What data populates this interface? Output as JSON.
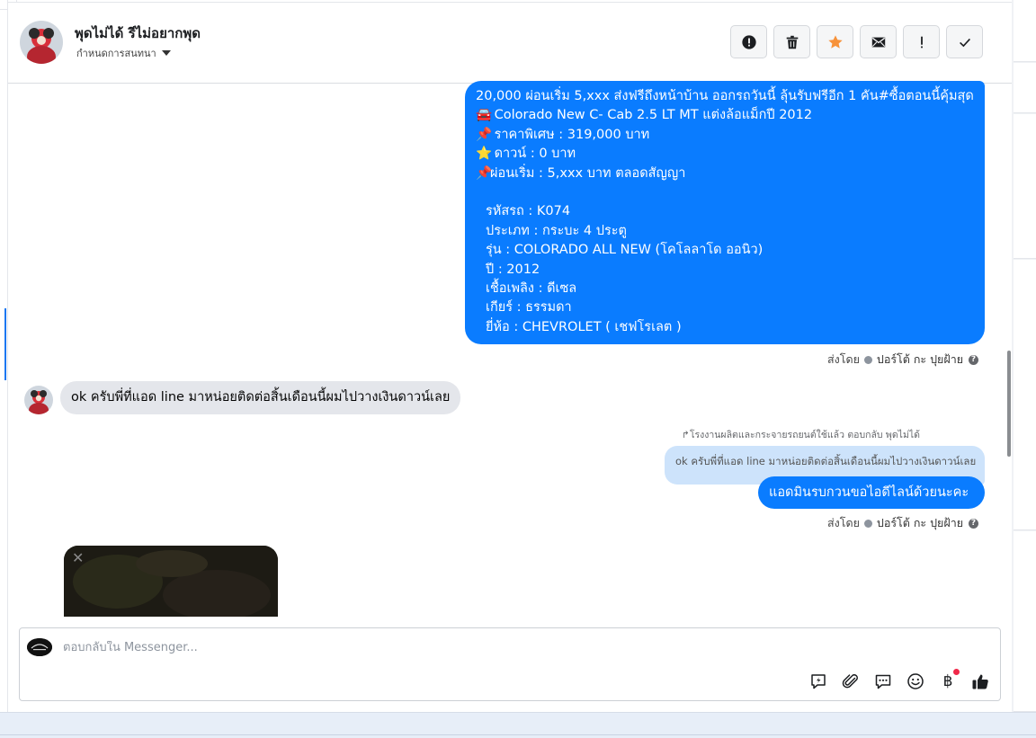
{
  "header": {
    "contact_name": "พุดไม่ได้ รีไม่อยากพุด",
    "conversation_setting": "กำหนดการสนทนา",
    "actions": [
      {
        "name": "spam-button",
        "icon": "alert-circle-icon"
      },
      {
        "name": "delete-button",
        "icon": "trash-icon"
      },
      {
        "name": "star-button",
        "icon": "star-icon"
      },
      {
        "name": "unread-button",
        "icon": "envelope-icon"
      },
      {
        "name": "important-button",
        "icon": "exclamation-icon"
      },
      {
        "name": "done-button",
        "icon": "check-icon"
      }
    ]
  },
  "messages": {
    "offer": {
      "lines": [
        {
          "emoji": "",
          "text": "20,000 ผ่อนเริ่ม 5,xxx ส่งฟรีถึงหน้าบ้าน ออกรถวันนี้ ลุ้นรับฟรีอีก 1 คัน#ซื้อตอนนี้คุ้มสุด"
        },
        {
          "emoji": "🚘",
          "text": " Colorado New C- Cab 2.5 LT MT แต่งล้อแม็กปี 2012"
        },
        {
          "emoji": "📌",
          "text": " ราคาพิเศษ : 319,000 บาท"
        },
        {
          "emoji": "⭐",
          "text": " ดาวน์ : 0 บาท"
        },
        {
          "emoji": "📌",
          "text": "ผ่อนเริ่ม : 5,xxx บาท ตลอดสัญญา"
        }
      ],
      "specs": [
        "รหัสรถ : K074",
        "ประเภท : กระบะ 4 ประตู",
        "รุ่น : COLORADO ALL NEW (โคโลลาโด ออนิว)",
        "ปี : 2012",
        "เชื้อเพลิง : ดีเซล",
        "เกียร์ : ธรรมดา",
        "ยี่ห้อ : CHEVROLET ( เชฟโรเลต )"
      ]
    },
    "sent_by_label": "ส่งโดย",
    "sent_by_name": "ปอร์โต้ กะ ปุยฝ้าย",
    "help_glyph": "?",
    "customer_message": "ok ครับพี่ที่แอด line มาหน่อยติดต่อสิ้นเดือนนี้ผมไปวางเงินดาวน์เลย",
    "reply_meta": "โรงงานผลิตและกระจายรถยนต์ใช้แล้ว ตอบกลับ พุดไม่ได้",
    "quoted_text": "ok ครับพี่ที่แอด line มาหน่อยติดต่อสิ้นเดือนนี้ผมไปวางเงินดาวน์เลย",
    "reply_text": "แอดมินรบกวนขอไอดีไลน์ด้วยนะคะ",
    "media_close_glyph": "✕"
  },
  "composer": {
    "placeholder": "ตอบกลับใน Messenger...",
    "tools": [
      "saved-reply-icon",
      "attachment-icon",
      "chat-bubble-icon",
      "emoji-icon",
      "baht-icon",
      "thumbs-up-icon"
    ],
    "baht_glyph": "฿"
  },
  "colors": {
    "accent": "#0a7cff",
    "star": "#f7923a",
    "incoming_bubble": "#e4e6eb",
    "quoted_bubble": "#cde3fb"
  }
}
